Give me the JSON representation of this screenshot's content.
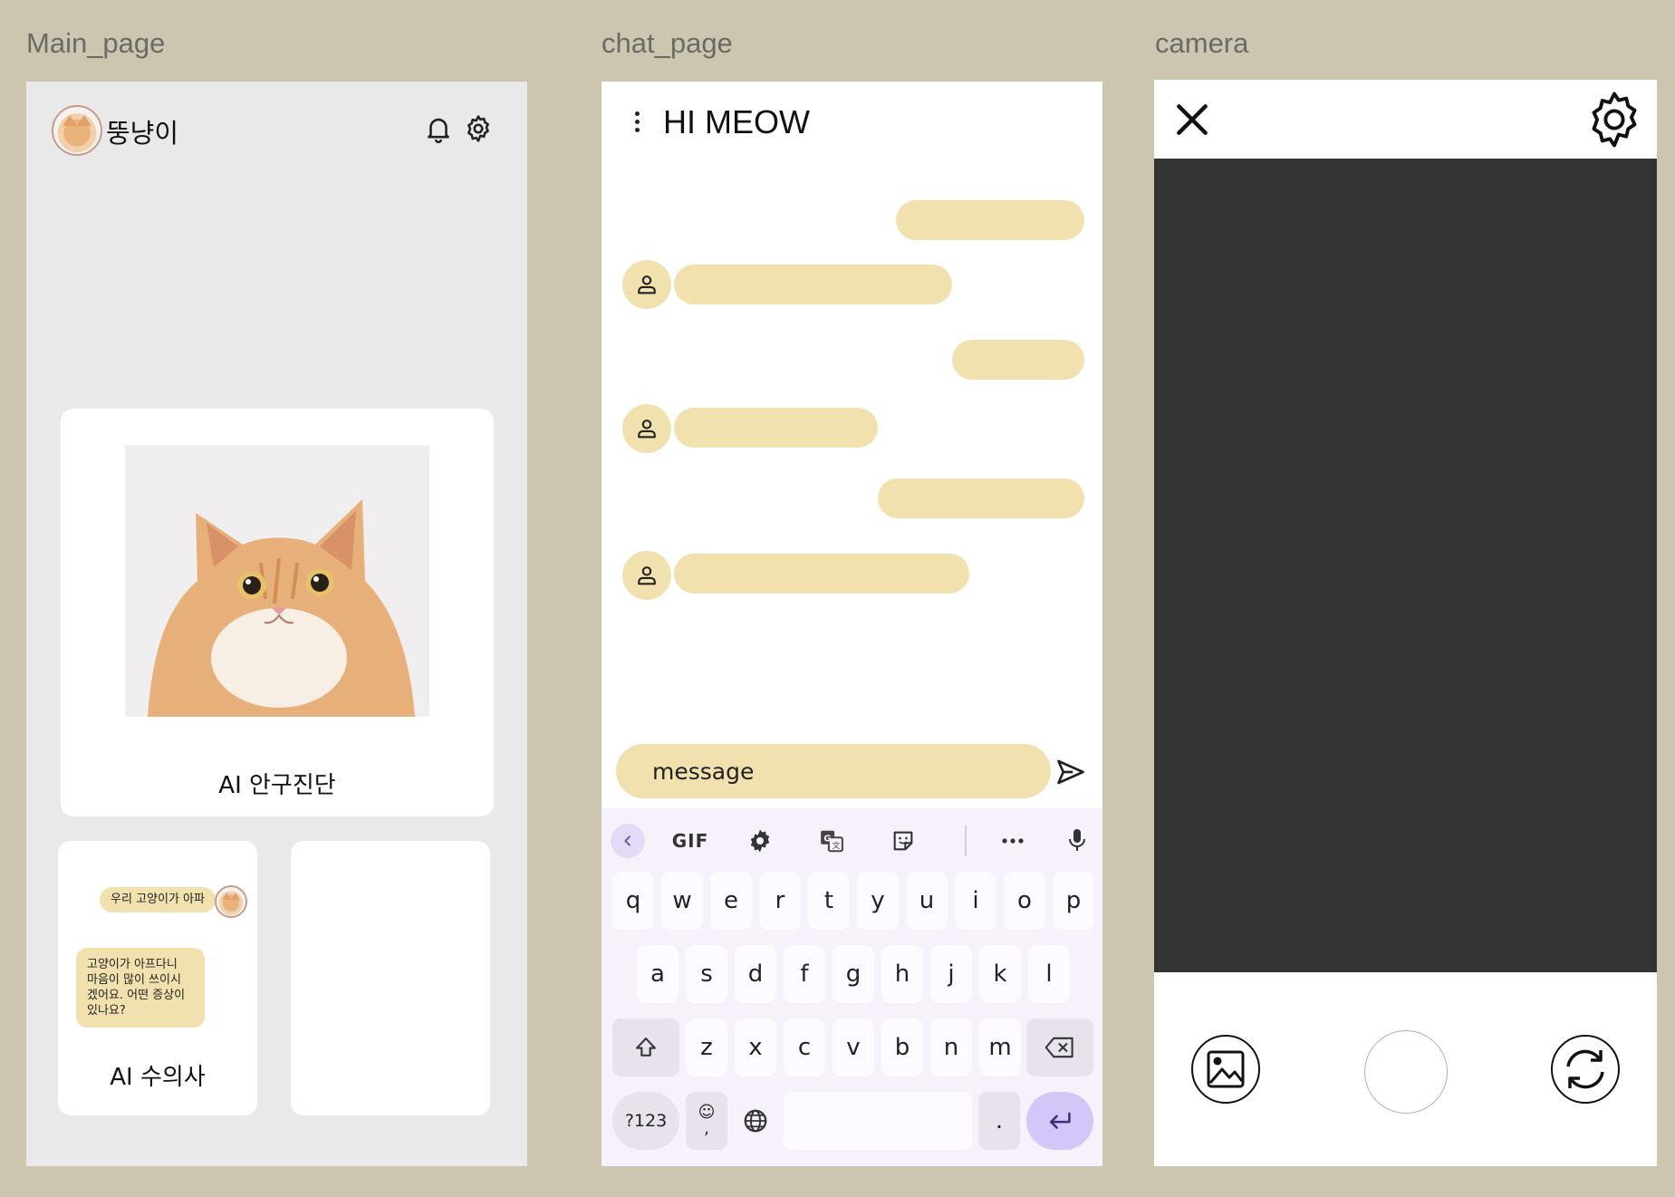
{
  "frames": {
    "main": {
      "label": "Main_page",
      "profile_name": "뚱냥이",
      "diagnosis_card_title": "AI 안구진단",
      "vet_card": {
        "title": "AI 수의사",
        "user_message": "우리 고양이가 아파",
        "bot_message_lines": [
          "고양이가 아프다니",
          "마음이 많이 쓰이시",
          "겠어요. 어떤 증상이",
          "있나요?"
        ]
      }
    },
    "chat": {
      "label": "chat_page",
      "title": "HI MEOW",
      "input_placeholder": "message",
      "keyboard": {
        "toolbar": [
          "back-icon",
          "GIF",
          "gear-icon",
          "translate-icon",
          "sticker-icon",
          "more-icon",
          "mic-icon"
        ],
        "row1": [
          "q",
          "w",
          "e",
          "r",
          "t",
          "y",
          "u",
          "i",
          "o",
          "p"
        ],
        "row2": [
          "a",
          "s",
          "d",
          "f",
          "g",
          "h",
          "j",
          "k",
          "l"
        ],
        "row3": [
          "z",
          "x",
          "c",
          "v",
          "b",
          "n",
          "m"
        ],
        "symbols_key": "?123",
        "emoji_key_top": "☺",
        "emoji_key_bottom": ",",
        "period_key": "."
      }
    },
    "camera": {
      "label": "camera"
    }
  },
  "colors": {
    "background": "#CCC6B0",
    "bubble": "#F0E1AE",
    "viewfinder": "#333333",
    "keyboard_bg": "#F6F1FB",
    "accent_key": "#D4C7F7"
  }
}
